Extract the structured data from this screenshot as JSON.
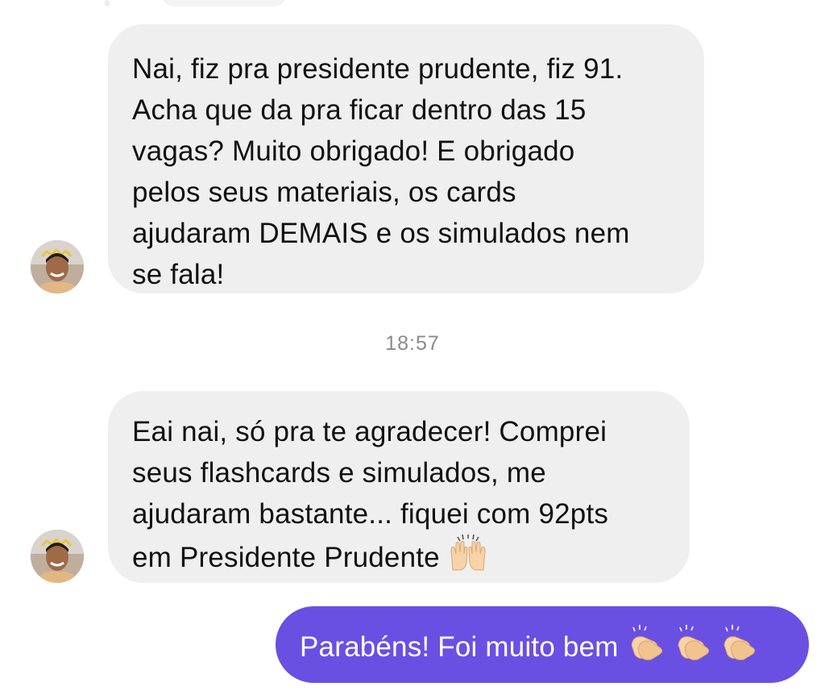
{
  "conversation": {
    "messages": [
      {
        "direction": "incoming",
        "lines": [
          "Nai, fiz pra presidente prudente, fiz 91.",
          "Acha que da pra ficar dentro das 15",
          "vagas? Muito obrigado! E obrigado",
          "pelos seus materiais, os cards",
          "ajudaram DEMAIS e os simulados nem",
          "se fala!"
        ]
      },
      {
        "direction": "incoming",
        "lines": [
          "Eai nai, só pra te agradecer! Comprei",
          "seus flashcards e simulados, me",
          "ajudaram bastante... fiquei com 92pts",
          "em Presidente Prudente"
        ],
        "trailing_emoji": "raising-hands-emoji"
      },
      {
        "direction": "outgoing",
        "text": "Parabéns! Foi muito bem",
        "trailing_emojis": [
          "clapping-hands-emoji",
          "clapping-hands-emoji",
          "clapping-hands-emoji"
        ]
      }
    ],
    "timestamp": "18:57"
  },
  "colors": {
    "incoming_bubble": "#efefef",
    "outgoing_bubble": "#6a4fe3",
    "timestamp_text": "#8a8a8a"
  }
}
